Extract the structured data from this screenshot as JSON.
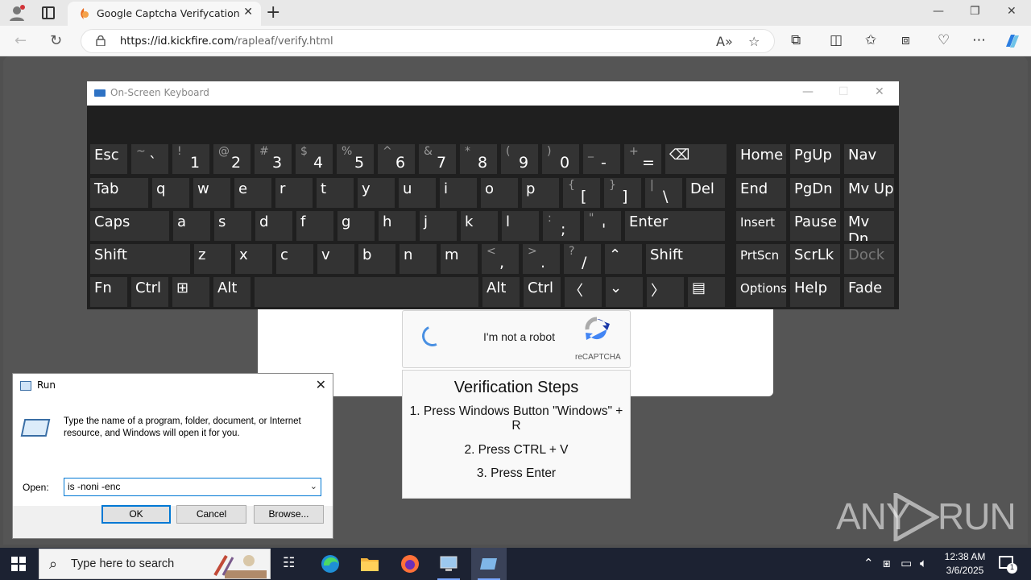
{
  "browser": {
    "tab_title": "Google Captcha Verifycation",
    "url_domain": "https://id.kickfire.com",
    "url_path": "/rapleaf/verify.html"
  },
  "captcha": {
    "checkbox_label": "I'm not a robot",
    "brand": "reCAPTCHA"
  },
  "steps": {
    "heading": "Verification Steps",
    "items": [
      "1. Press Windows Button \"Windows\" + R",
      "2. Press CTRL + V",
      "3. Press Enter"
    ]
  },
  "osk": {
    "title": "On-Screen Keyboard",
    "rows": [
      [
        {
          "label": "Esc"
        },
        {
          "up": "~",
          "lo": "`"
        },
        {
          "up": "!",
          "lo": "1"
        },
        {
          "up": "@",
          "lo": "2"
        },
        {
          "up": "#",
          "lo": "3"
        },
        {
          "up": "$",
          "lo": "4"
        },
        {
          "up": "%",
          "lo": "5"
        },
        {
          "up": "^",
          "lo": "6"
        },
        {
          "up": "&",
          "lo": "7"
        },
        {
          "up": "*",
          "lo": "8"
        },
        {
          "up": "(",
          "lo": "9"
        },
        {
          "up": ")",
          "lo": "0"
        },
        {
          "up": "_",
          "lo": "-"
        },
        {
          "up": "+",
          "lo": "="
        },
        {
          "label": "⌫"
        },
        {
          "label": "Home"
        },
        {
          "label": "PgUp"
        },
        {
          "label": "Nav"
        }
      ],
      [
        {
          "label": "Tab"
        },
        {
          "label": "q"
        },
        {
          "label": "w"
        },
        {
          "label": "e"
        },
        {
          "label": "r"
        },
        {
          "label": "t"
        },
        {
          "label": "y"
        },
        {
          "label": "u"
        },
        {
          "label": "i"
        },
        {
          "label": "o"
        },
        {
          "label": "p"
        },
        {
          "up": "{",
          "lo": "["
        },
        {
          "up": "}",
          "lo": "]"
        },
        {
          "up": "|",
          "lo": "\\"
        },
        {
          "label": "Del"
        },
        {
          "label": "End"
        },
        {
          "label": "PgDn"
        },
        {
          "label": "Mv Up"
        }
      ],
      [
        {
          "label": "Caps"
        },
        {
          "label": "a"
        },
        {
          "label": "s"
        },
        {
          "label": "d"
        },
        {
          "label": "f"
        },
        {
          "label": "g"
        },
        {
          "label": "h"
        },
        {
          "label": "j"
        },
        {
          "label": "k"
        },
        {
          "label": "l"
        },
        {
          "up": ":",
          "lo": ";"
        },
        {
          "up": "\"",
          "lo": "'"
        },
        {
          "label": "Enter"
        },
        {
          "label": "Insert"
        },
        {
          "label": "Pause"
        },
        {
          "label": "Mv Dn"
        }
      ],
      [
        {
          "label": "Shift"
        },
        {
          "label": "z"
        },
        {
          "label": "x"
        },
        {
          "label": "c"
        },
        {
          "label": "v"
        },
        {
          "label": "b"
        },
        {
          "label": "n"
        },
        {
          "label": "m"
        },
        {
          "up": "<",
          "lo": ","
        },
        {
          "up": ">",
          "lo": "."
        },
        {
          "up": "?",
          "lo": "/"
        },
        {
          "label": "⌃"
        },
        {
          "label": "Shift"
        },
        {
          "label": "PrtScn"
        },
        {
          "label": "ScrLk"
        },
        {
          "label": "Dock"
        }
      ],
      [
        {
          "label": "Fn"
        },
        {
          "label": "Ctrl"
        },
        {
          "label": "⊞"
        },
        {
          "label": "Alt"
        },
        {
          "label": ""
        },
        {
          "label": "Alt"
        },
        {
          "label": "Ctrl"
        },
        {
          "label": "〈"
        },
        {
          "label": "⌄"
        },
        {
          "label": "〉"
        },
        {
          "label": "▤"
        },
        {
          "label": "Options"
        },
        {
          "label": "Help"
        },
        {
          "label": "Fade"
        }
      ]
    ]
  },
  "run": {
    "title": "Run",
    "description": "Type the name of a program, folder, document, or Internet resource, and Windows will open it for you.",
    "open_label": "Open:",
    "value": "is -noni -enc",
    "ok": "OK",
    "cancel": "Cancel",
    "browse": "Browse..."
  },
  "watermark": {
    "left": "ANY",
    "right": "RUN"
  },
  "taskbar": {
    "search_placeholder": "Type here to search",
    "time": "12:38 AM",
    "date": "3/6/2025",
    "notifications": "1"
  }
}
